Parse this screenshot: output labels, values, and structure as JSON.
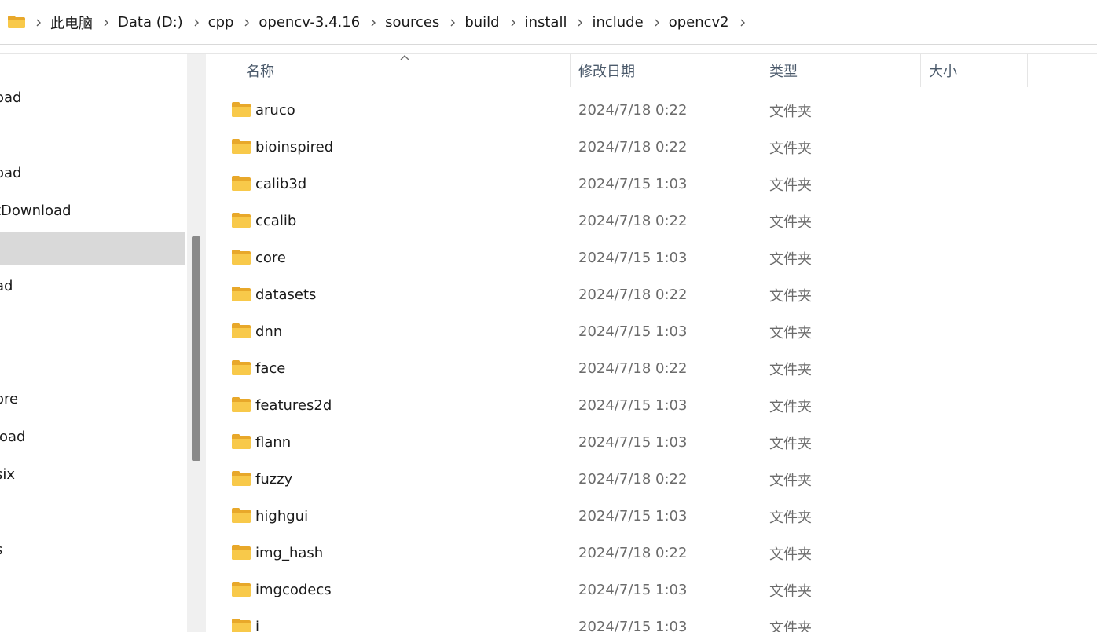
{
  "breadcrumb": {
    "icon": "folder-icon",
    "items": [
      "此电脑",
      "Data (D:)",
      "cpp",
      "opencv-3.4.16",
      "sources",
      "build",
      "install",
      "include",
      "opencv2"
    ]
  },
  "nav": {
    "items": [
      {
        "label": "oad",
        "selected": false
      },
      {
        "label": "oad",
        "selected": false
      },
      {
        "label": "tDownload",
        "selected": false
      },
      {
        "label": "",
        "selected": true
      },
      {
        "label": "ad",
        "selected": false
      },
      {
        "label": "ore",
        "selected": false
      },
      {
        "label": "load",
        "selected": false
      },
      {
        "label": "six",
        "selected": false
      },
      {
        "label": "s",
        "selected": false
      }
    ]
  },
  "columns": {
    "name": "名称",
    "date": "修改日期",
    "type": "类型",
    "size": "大小"
  },
  "files": [
    {
      "name": "aruco",
      "date": "2024/7/18 0:22",
      "type": "文件夹"
    },
    {
      "name": "bioinspired",
      "date": "2024/7/18 0:22",
      "type": "文件夹"
    },
    {
      "name": "calib3d",
      "date": "2024/7/15 1:03",
      "type": "文件夹"
    },
    {
      "name": "ccalib",
      "date": "2024/7/18 0:22",
      "type": "文件夹"
    },
    {
      "name": "core",
      "date": "2024/7/15 1:03",
      "type": "文件夹"
    },
    {
      "name": "datasets",
      "date": "2024/7/18 0:22",
      "type": "文件夹"
    },
    {
      "name": "dnn",
      "date": "2024/7/15 1:03",
      "type": "文件夹"
    },
    {
      "name": "face",
      "date": "2024/7/18 0:22",
      "type": "文件夹"
    },
    {
      "name": "features2d",
      "date": "2024/7/15 1:03",
      "type": "文件夹"
    },
    {
      "name": "flann",
      "date": "2024/7/15 1:03",
      "type": "文件夹"
    },
    {
      "name": "fuzzy",
      "date": "2024/7/18 0:22",
      "type": "文件夹"
    },
    {
      "name": "highgui",
      "date": "2024/7/15 1:03",
      "type": "文件夹"
    },
    {
      "name": "img_hash",
      "date": "2024/7/18 0:22",
      "type": "文件夹"
    },
    {
      "name": "imgcodecs",
      "date": "2024/7/15 1:03",
      "type": "文件夹"
    },
    {
      "name": "i",
      "date": "2024/7/15 1:03",
      "type": "文件夹"
    }
  ],
  "colors": {
    "folder_yellow": "#f8c94a",
    "folder_dark": "#e8a82a",
    "selected_nav": "#d9d9d9",
    "header_text": "#4b5a6b"
  }
}
